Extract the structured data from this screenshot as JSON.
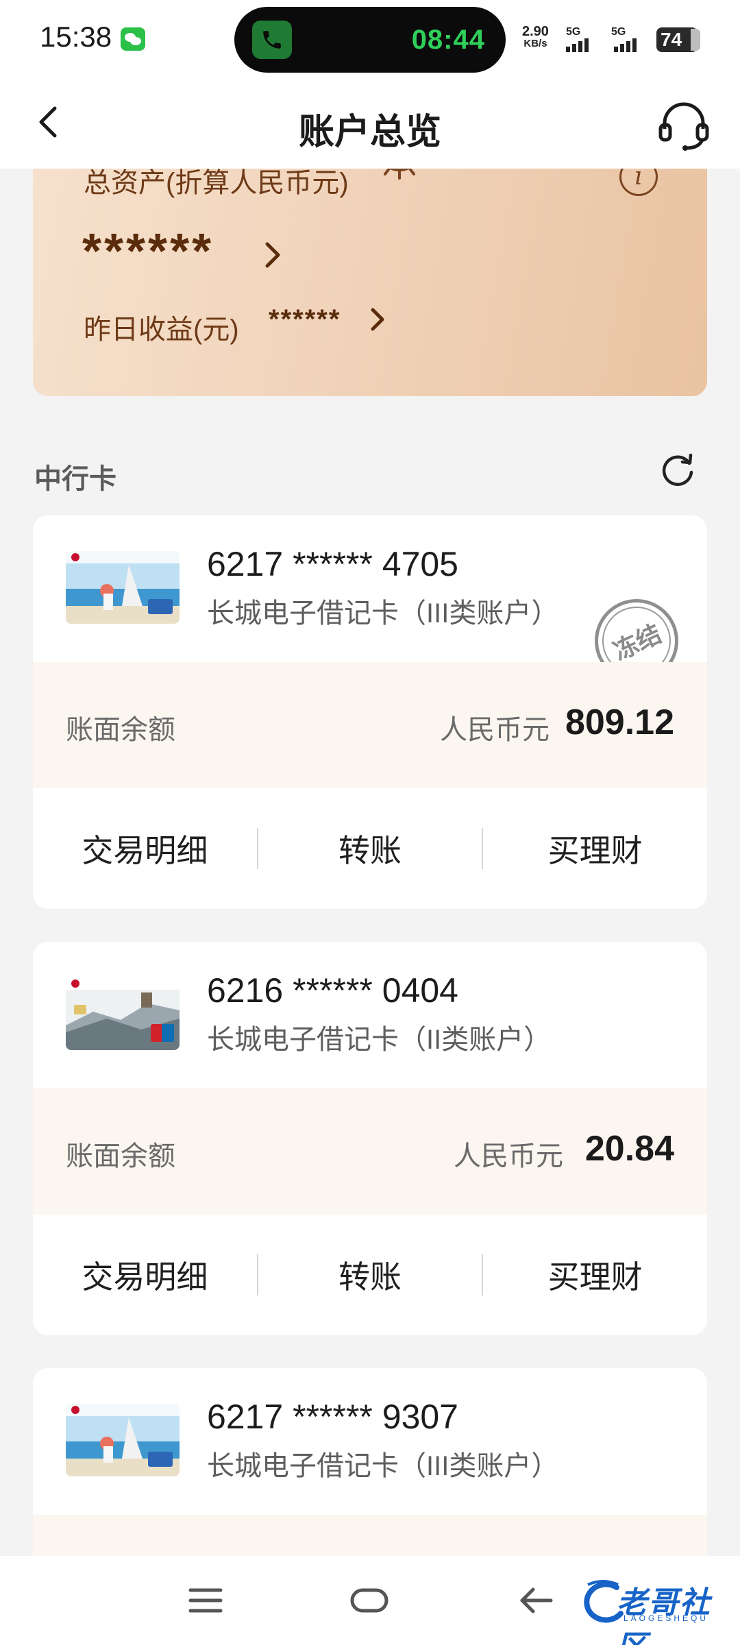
{
  "status_bar": {
    "time": "15:38",
    "call_time": "08:44",
    "net_speed_value": "2.90",
    "net_speed_unit": "KB/s",
    "sim1": "5G",
    "sim2": "5G",
    "battery": "74",
    "icons": [
      "wechat-icon",
      "phone-icon",
      "signal-icon",
      "battery-icon"
    ]
  },
  "header": {
    "title": "账户总览",
    "icons": [
      "back-arrow-icon",
      "headset-icon"
    ]
  },
  "assets": {
    "total_label": "总资产(折算人民币元)",
    "total_value": "******",
    "yesterday_label": "昨日收益(元)",
    "yesterday_value": "******",
    "info_glyph": "i"
  },
  "section": {
    "title": "中行卡"
  },
  "accounts": [
    {
      "card_number": "6217 ****** 4705",
      "card_type": "长城电子借记卡（III类账户）",
      "stamp": "冻结",
      "balance_label": "账面余额",
      "currency": "人民币元",
      "balance": "809.12",
      "actions": [
        "交易明细",
        "转账",
        "买理财"
      ]
    },
    {
      "card_number": "6216 ****** 0404",
      "card_type": "长城电子借记卡（II类账户）",
      "balance_label": "账面余额",
      "currency": "人民币元",
      "balance": "20.84",
      "actions": [
        "交易明细",
        "转账",
        "买理财"
      ]
    },
    {
      "card_number": "6217 ****** 9307",
      "card_type": "长城电子借记卡（III类账户）"
    }
  ],
  "watermark": {
    "text": "老哥社区",
    "sub": "LAOGESHEQU"
  },
  "colors": {
    "asset_card_start": "#f6e1cd",
    "asset_card_end": "#e9c3a2",
    "asset_text": "#6e3a17",
    "balance_bg": "#fbf6ef",
    "watermark": "#1763c7"
  }
}
